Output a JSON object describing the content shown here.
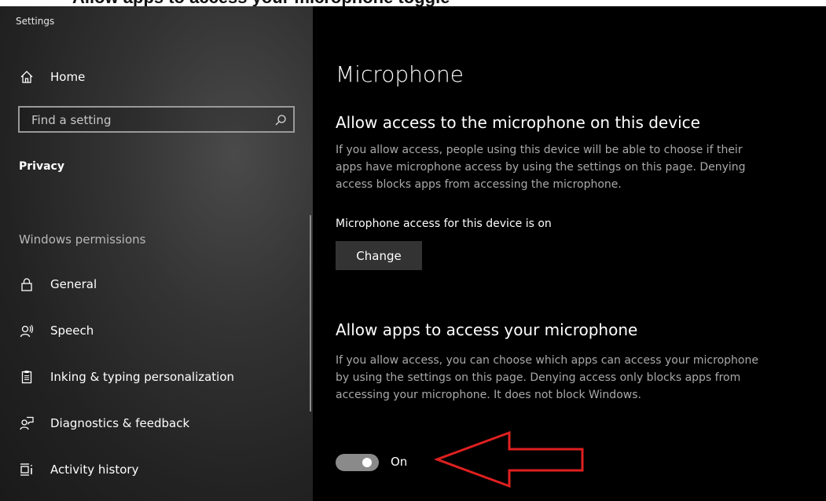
{
  "caption": "Allow apps to access your microphone toggle",
  "window": {
    "title": "Settings"
  },
  "sidebar": {
    "home_label": "Home",
    "search_placeholder": "Find a setting",
    "section": "Privacy",
    "group_title": "Windows permissions",
    "items": [
      {
        "label": "General",
        "icon": "lock-icon"
      },
      {
        "label": "Speech",
        "icon": "speech-icon"
      },
      {
        "label": "Inking & typing personalization",
        "icon": "clipboard-icon"
      },
      {
        "label": "Diagnostics & feedback",
        "icon": "feedback-icon"
      },
      {
        "label": "Activity history",
        "icon": "activity-icon"
      }
    ]
  },
  "main": {
    "title": "Microphone",
    "device_access": {
      "heading": "Allow access to the microphone on this device",
      "description": "If you allow access, people using this device will be able to choose if their apps have microphone access by using the settings on this page. Denying access blocks apps from accessing the microphone.",
      "status": "Microphone access for this device is on",
      "change_label": "Change"
    },
    "app_access": {
      "heading": "Allow apps to access your microphone",
      "description": "If you allow access, you can choose which apps can access your microphone by using the settings on this page. Denying access only blocks apps from accessing your microphone. It does not block Windows.",
      "toggle_state": "On",
      "toggle_on": true
    }
  },
  "colors": {
    "background": "#000000",
    "sidebar_bg": "#2b2b2b",
    "annotation_arrow": "#e02020",
    "toggle_track": "#8a8a8a"
  }
}
